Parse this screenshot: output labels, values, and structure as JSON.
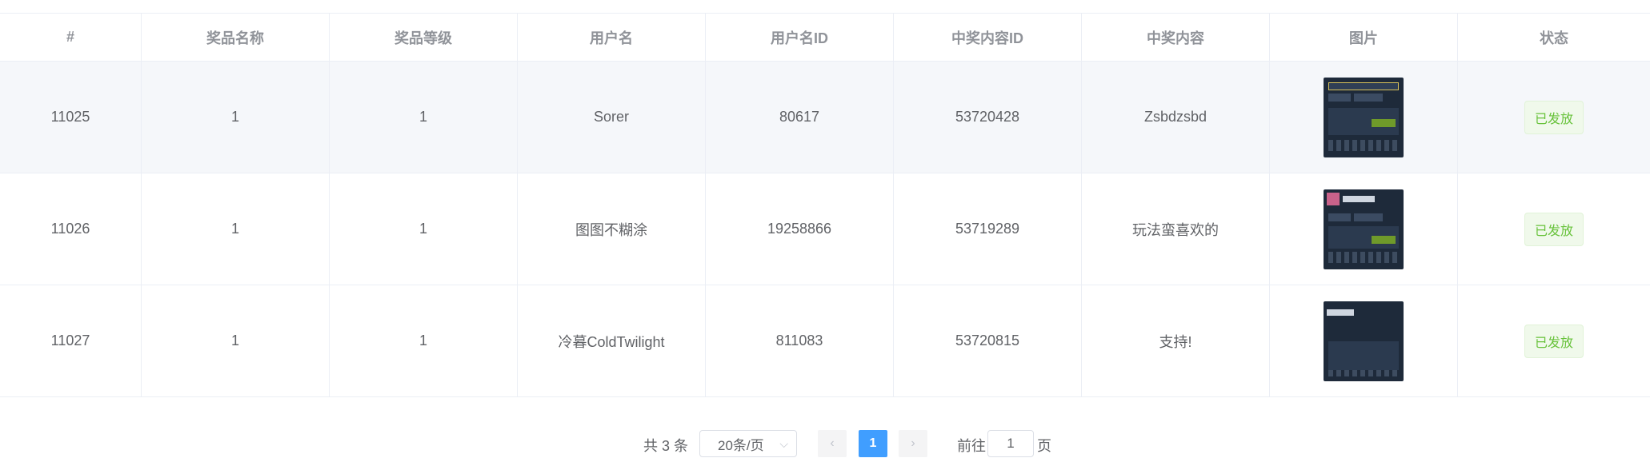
{
  "table": {
    "headers": [
      "#",
      "奖品名称",
      "奖品等级",
      "用户名",
      "用户名ID",
      "中奖内容ID",
      "中奖内容",
      "图片",
      "状态"
    ],
    "rows": [
      {
        "id": "11025",
        "prize_name": "1",
        "prize_level": "1",
        "username": "Sorer",
        "user_id": "80617",
        "content_id": "53720428",
        "content": "Zsbdzsbd",
        "status": "已发放"
      },
      {
        "id": "11026",
        "prize_name": "1",
        "prize_level": "1",
        "username": "图图不糊涂",
        "user_id": "19258866",
        "content_id": "53719289",
        "content": "玩法蛮喜欢的",
        "status": "已发放"
      },
      {
        "id": "11027",
        "prize_name": "1",
        "prize_level": "1",
        "username": "冷暮ColdTwilight",
        "user_id": "811083",
        "content_id": "53720815",
        "content": "支持!",
        "status": "已发放"
      }
    ]
  },
  "pagination": {
    "total": "共 3 条",
    "page_size": "20条/页",
    "current_page": "1",
    "goto_label": "前往",
    "goto_value": "1",
    "page_unit": "页",
    "prev_icon": "chevron-left-icon",
    "next_icon": "chevron-right-icon"
  },
  "colors": {
    "accent": "#409eff",
    "success": "#67c23a",
    "stripe": "#f5f7fa"
  }
}
